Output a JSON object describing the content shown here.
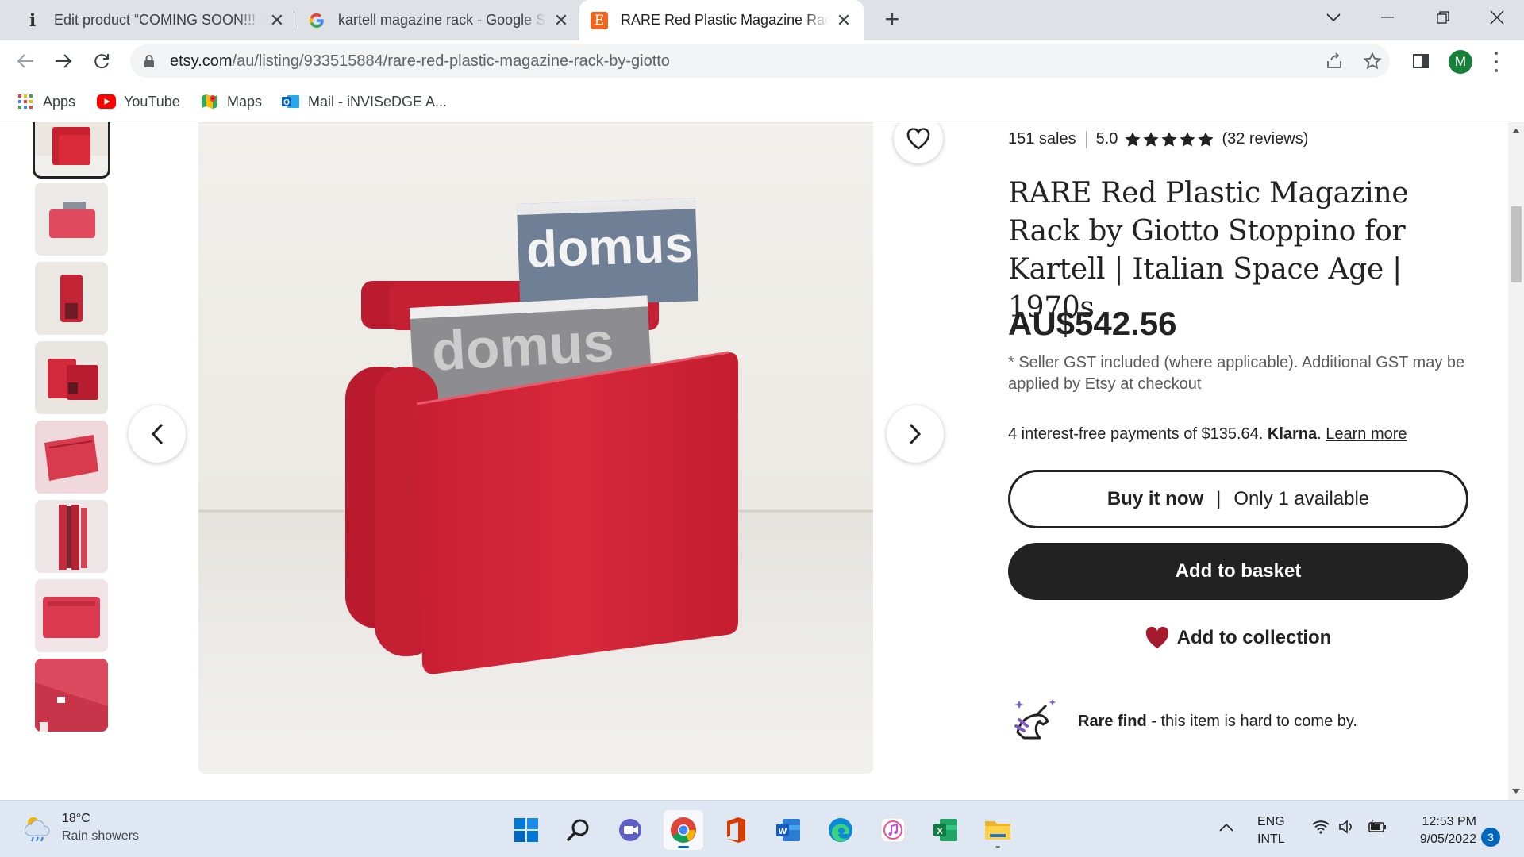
{
  "tabs": [
    {
      "icon": "info-icon",
      "title": "Edit product “COMING SOON!!! SOLD OUT",
      "active": false
    },
    {
      "icon": "google-icon",
      "title": "kartell magazine rack - Google Search",
      "active": false
    },
    {
      "icon": "etsy-icon",
      "title": "RARE Red Plastic Magazine Rack by Giotto",
      "active": true
    }
  ],
  "omnibox": {
    "host": "etsy.com",
    "path": "/au/listing/933515884/rare-red-plastic-magazine-rack-by-giotto"
  },
  "profile": {
    "initial": "M"
  },
  "bookmarks": [
    {
      "label": "Apps",
      "icon": "apps-grid-icon"
    },
    {
      "label": "YouTube",
      "icon": "youtube-icon"
    },
    {
      "label": "Maps",
      "icon": "maps-icon"
    },
    {
      "label": "Mail - iNVISeDGE A...",
      "icon": "outlook-icon"
    }
  ],
  "listing": {
    "sales": "151 sales",
    "rating": "5.0",
    "rating_value": 5,
    "reviews": "(32 reviews)",
    "title": "RARE Red Plastic Magazine Rack by Giotto Stoppino for Kartell | Italian Space Age | 1970s",
    "price": "AU$542.56",
    "gst_note": "* Seller GST included (where applicable). Additional GST may be applied by Etsy at checkout",
    "klarna_text": "4 interest-free payments of $135.64.",
    "klarna_brand": "Klarna",
    "klarna_dot": ".",
    "klarna_link": "Learn more",
    "buy_now": "Buy it now",
    "buy_sep": "|",
    "availability": "Only 1 available",
    "add_to_basket": "Add to basket",
    "add_to_collection": "Add to collection",
    "rare_find": "Rare find",
    "rare_find_desc": " - this item is hard to come by.",
    "thumbnail_count": 8
  },
  "colors": {
    "etsy_orange": "#f1641e",
    "product_red": "#d4263a",
    "buy_black": "#222222",
    "collect_heart": "#a61a2e"
  },
  "taskbar": {
    "weather_temp": "18°C",
    "weather_desc": "Rain showers",
    "lang_1": "ENG",
    "lang_2": "INTL",
    "time": "12:53 PM",
    "date": "9/05/2022",
    "notifications": "3",
    "apps": [
      "windows-start-icon",
      "search-icon",
      "teams-chat-icon",
      "chrome-icon",
      "office-icon",
      "word-icon",
      "edge-icon",
      "itunes-icon",
      "excel-icon",
      "file-explorer-icon"
    ]
  }
}
